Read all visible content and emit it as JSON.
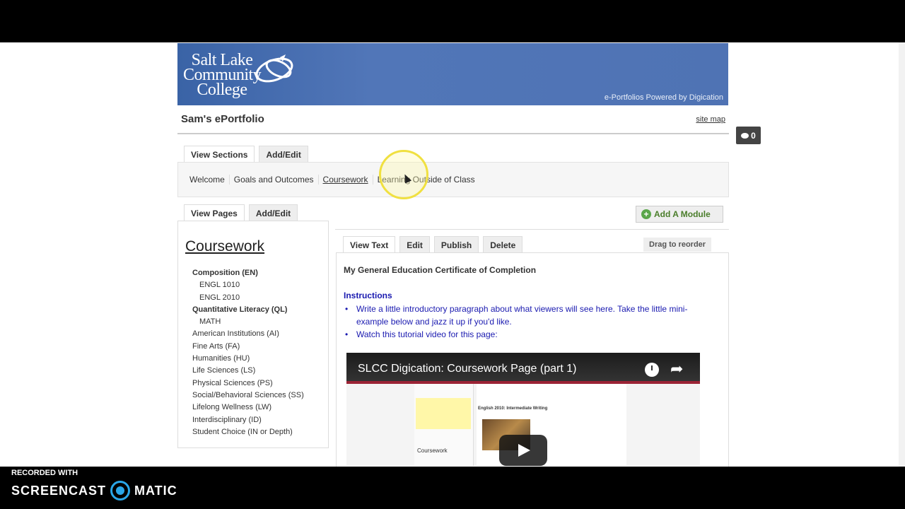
{
  "banner": {
    "logo_lines": [
      "Salt Lake",
      "Community",
      "College"
    ],
    "powered_by": "e-Portfolios Powered by Digication"
  },
  "portfolio_title": "Sam's ePortfolio",
  "site_map": "site map",
  "comment_count": "0",
  "section_tabs": [
    "View Sections",
    "Add/Edit"
  ],
  "sections": [
    "Welcome",
    "Goals and Outcomes",
    "Coursework",
    "Learning Outside of Class"
  ],
  "page_tabs": [
    "View Pages",
    "Add/Edit"
  ],
  "sidebar": {
    "title": "Coursework",
    "items": [
      {
        "label": "Composition (EN)",
        "style": "bold"
      },
      {
        "label": "ENGL 1010",
        "style": "sub"
      },
      {
        "label": "ENGL 2010",
        "style": "sub"
      },
      {
        "label": "Quantitative Literacy (QL)",
        "style": "bold"
      },
      {
        "label": "MATH",
        "style": "sub"
      },
      {
        "label": "American Institutions (AI)",
        "style": "normal"
      },
      {
        "label": "Fine Arts (FA)",
        "style": "normal"
      },
      {
        "label": "Humanities (HU)",
        "style": "normal"
      },
      {
        "label": "Life Sciences (LS)",
        "style": "normal"
      },
      {
        "label": "Physical Sciences (PS)",
        "style": "normal"
      },
      {
        "label": "Social/Behavioral Sciences (SS)",
        "style": "normal"
      },
      {
        "label": "Lifelong Wellness (LW)",
        "style": "normal"
      },
      {
        "label": "Interdisciplinary (ID)",
        "style": "normal"
      },
      {
        "label": "Student Choice (IN or Depth)",
        "style": "normal"
      }
    ]
  },
  "add_module": "Add A Module",
  "module_tabs": [
    "View Text",
    "Edit",
    "Publish",
    "Delete"
  ],
  "drag_to_reorder": "Drag to reorder",
  "module": {
    "title": "My General Education Certificate of Completion",
    "instructions_heading": "Instructions",
    "instructions": [
      "Write a little introductory paragraph about what viewers will see here. Take the little mini-example below and jazz it up if you'd like.",
      "Watch this tutorial video for this page:"
    ]
  },
  "video": {
    "title": "SLCC Digication: Coursework Page (part 1)",
    "inner_heading": "English 2010: Intermediate Writing",
    "inner_course": "Coursework"
  },
  "watermark": {
    "recorded_with": "RECORDED WITH",
    "brand_left": "SCREENCAST",
    "brand_right": "MATIC"
  }
}
